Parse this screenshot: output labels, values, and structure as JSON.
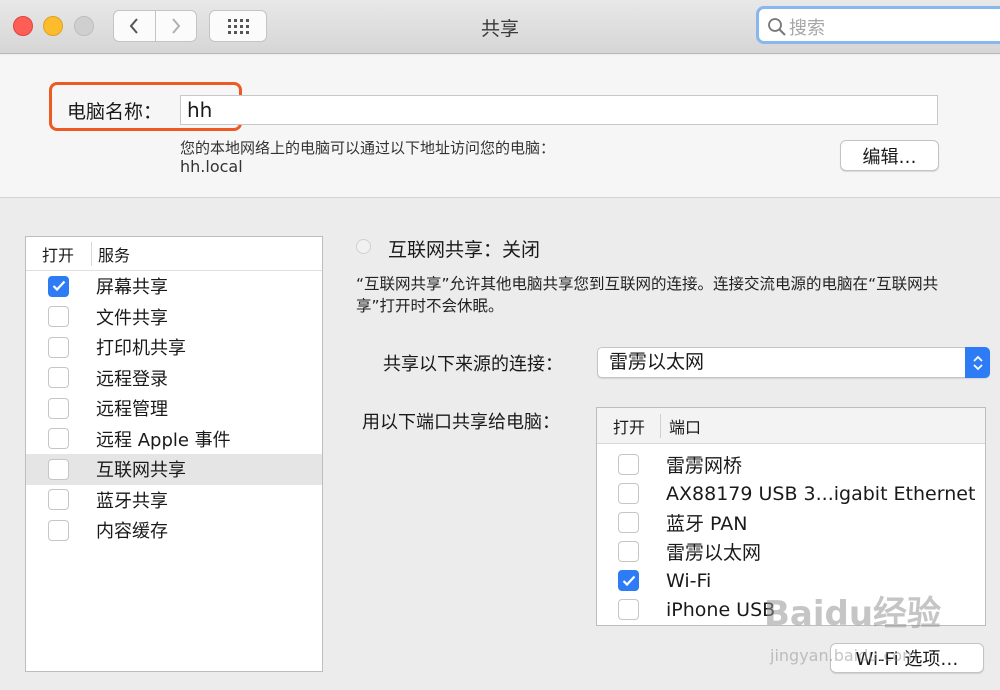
{
  "window": {
    "title": "共享"
  },
  "toolbar": {
    "search_placeholder": "搜索"
  },
  "computer_name": {
    "label": "电脑名称：",
    "value": "hh",
    "hint": "您的本地网络上的电脑可以通过以下地址访问您的电脑：",
    "address": "hh.local",
    "edit_label": "编辑…"
  },
  "services": {
    "col_on": "打开",
    "col_service": "服务",
    "items": [
      {
        "label": "屏幕共享",
        "checked": true,
        "selected": false
      },
      {
        "label": "文件共享",
        "checked": false,
        "selected": false
      },
      {
        "label": "打印机共享",
        "checked": false,
        "selected": false
      },
      {
        "label": "远程登录",
        "checked": false,
        "selected": false
      },
      {
        "label": "远程管理",
        "checked": false,
        "selected": false
      },
      {
        "label": "远程 Apple 事件",
        "checked": false,
        "selected": false
      },
      {
        "label": "互联网共享",
        "checked": false,
        "selected": true
      },
      {
        "label": "蓝牙共享",
        "checked": false,
        "selected": false
      },
      {
        "label": "内容缓存",
        "checked": false,
        "selected": false
      }
    ]
  },
  "internet_sharing": {
    "status": "互联网共享：关闭",
    "description": "“互联网共享”允许其他电脑共享您到互联网的连接。连接交流电源的电脑在“互联网共享”打开时不会休眠。",
    "source_label": "共享以下来源的连接：",
    "source_value": "雷雳以太网",
    "ports_label": "用以下端口共享给电脑：",
    "ports_col_on": "打开",
    "ports_col_port": "端口",
    "ports": [
      {
        "label": "雷雳网桥",
        "checked": false
      },
      {
        "label": "AX88179 USB 3...igabit Ethernet",
        "checked": false
      },
      {
        "label": "蓝牙 PAN",
        "checked": false
      },
      {
        "label": "雷雳以太网",
        "checked": false
      },
      {
        "label": "Wi-Fi",
        "checked": true
      },
      {
        "label": "iPhone USB",
        "checked": false
      }
    ],
    "wifi_options_label": "Wi-Fi 选项…"
  },
  "watermark": {
    "text": "Baidu经验",
    "sub": "jingyan.baidu.com"
  }
}
